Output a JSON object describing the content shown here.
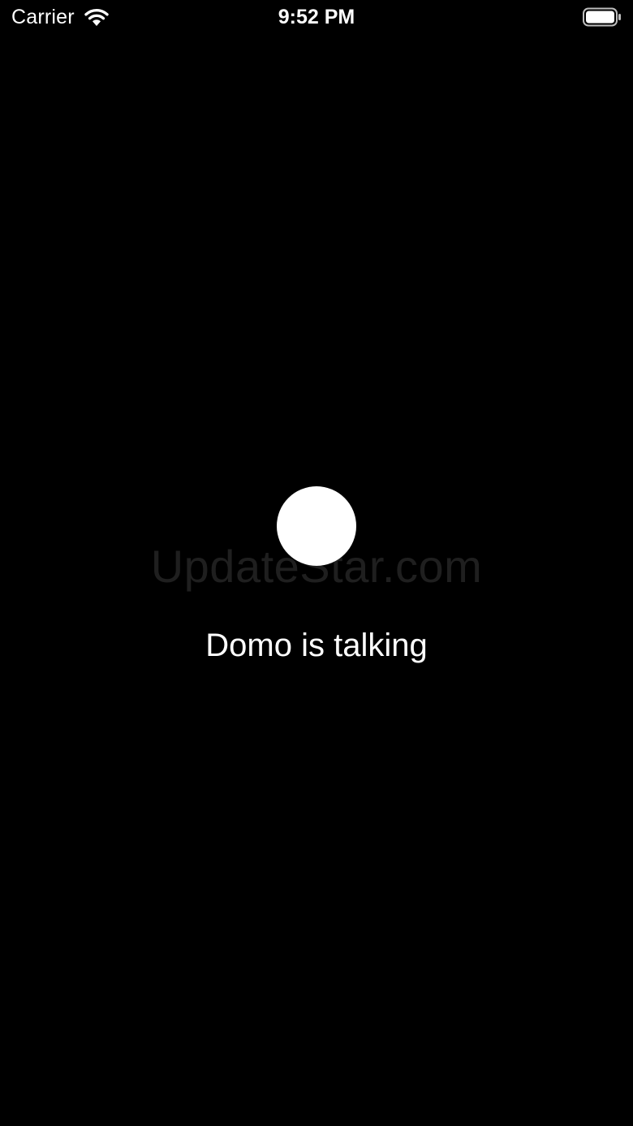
{
  "status_bar": {
    "carrier": "Carrier",
    "time": "9:52 PM",
    "wifi_icon": "wifi-icon",
    "battery_icon": "battery-full-icon"
  },
  "main": {
    "watermark": "UpdateStar.com",
    "indicator_color": "#ffffff",
    "status_label": "Domo is talking"
  },
  "colors": {
    "background": "#000000",
    "text": "#ffffff"
  }
}
